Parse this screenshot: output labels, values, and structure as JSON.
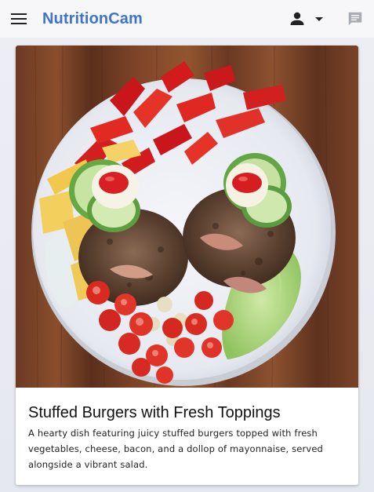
{
  "app_bar": {
    "title": "NutritionCam",
    "menu_icon": "hamburger-menu-icon",
    "account_icon": "person-icon",
    "account_dropdown_icon": "caret-down-icon",
    "chat_icon": "chat-bubble-icon"
  },
  "card": {
    "image_alt": "Stuffed burgers with fresh toppings on a plate",
    "title": "Stuffed Burgers with Fresh Toppings",
    "description": "A hearty dish featuring juicy stuffed burgers topped with fresh vegetables, cheese, bacon, and a dollop of mayonnaise, served alongside a vibrant salad."
  },
  "colors": {
    "brand": "#3f74c8",
    "app_bar_bg": "#f7f7f9",
    "page_bg": "#e9ebf1",
    "card_bg": "#ffffff"
  }
}
